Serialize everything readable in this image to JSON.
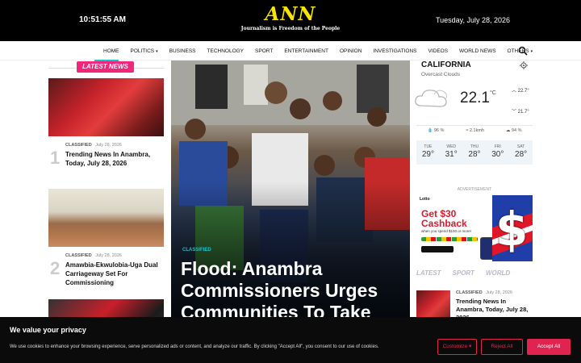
{
  "header": {
    "time": "10:51:55 AM",
    "date": "Tuesday, July 28, 2026",
    "logo": "ANN",
    "tagline": "Journalism is Freedom of the People"
  },
  "nav": {
    "items": [
      {
        "label": "HOME",
        "dropdown": false
      },
      {
        "label": "POLITICS",
        "dropdown": true
      },
      {
        "label": "BUSINESS",
        "dropdown": false
      },
      {
        "label": "TECHNOLOGY",
        "dropdown": false
      },
      {
        "label": "SPORT",
        "dropdown": false
      },
      {
        "label": "ENTERTAINMENT",
        "dropdown": false
      },
      {
        "label": "OPINION",
        "dropdown": false
      },
      {
        "label": "INVESTIGATIONS",
        "dropdown": false
      },
      {
        "label": "VIDEOS",
        "dropdown": false
      },
      {
        "label": "WORLD NEWS",
        "dropdown": false
      },
      {
        "label": "OTHERS",
        "dropdown": true
      }
    ],
    "search_icon": "search-icon"
  },
  "latest": {
    "heading": "LATEST NEWS",
    "stories": [
      {
        "num": "1",
        "category": "CLASSIFIED",
        "date": "July 28, 2026",
        "title": "Trending News In Anambra, Today, July 28, 2026"
      },
      {
        "num": "2",
        "category": "CLASSIFIED",
        "date": "July 28, 2026",
        "title": "Amawbia-Ekwulobia-Uga Dual Carriageway Set For Commissioning"
      }
    ]
  },
  "hero": {
    "category": "CLASSIFIED",
    "headline": "Flood: Anambra Commissioners Urges Communities To Take"
  },
  "weather": {
    "city": "CALIFORNIA",
    "condition": "Overcast Clouds",
    "temp": "22.1",
    "unit": "°C",
    "high": "22.7°",
    "low": "21.7°",
    "humidity": "96 %",
    "wind": "2.1kmh",
    "clouds": "94 %",
    "forecast": [
      {
        "day": "TUE",
        "temp": "29°"
      },
      {
        "day": "WED",
        "temp": "31°"
      },
      {
        "day": "THU",
        "temp": "28°"
      },
      {
        "day": "FRI",
        "temp": "30°"
      },
      {
        "day": "SAT",
        "temp": "28°"
      }
    ]
  },
  "ad": {
    "label": "ADVERTISEMENT",
    "brand": "Lotto",
    "headline1": "Get $30",
    "headline2": "Cashback",
    "small": "when you spend $100 or more!"
  },
  "sidebar_tabs": [
    "LATEST",
    "SPORT",
    "WORLD"
  ],
  "sidebar_story": {
    "category": "CLASSIFIED",
    "date": "July 28, 2026",
    "title": "Trending News In Anambra, Today, July 28, 2026"
  },
  "cookie": {
    "title": "We value your privacy",
    "text": "We use cookies to enhance your browsing experience, serve personalized ads or content, and analyze our traffic. By clicking \"Accept All\", you consent to our use of cookies.",
    "customize": "Customize",
    "reject": "Reject All",
    "accept": "Accept All"
  },
  "colors": {
    "accent": "#f0277a",
    "teal": "#18c0c8",
    "logo": "#f5e500",
    "button": "#e0234f"
  }
}
